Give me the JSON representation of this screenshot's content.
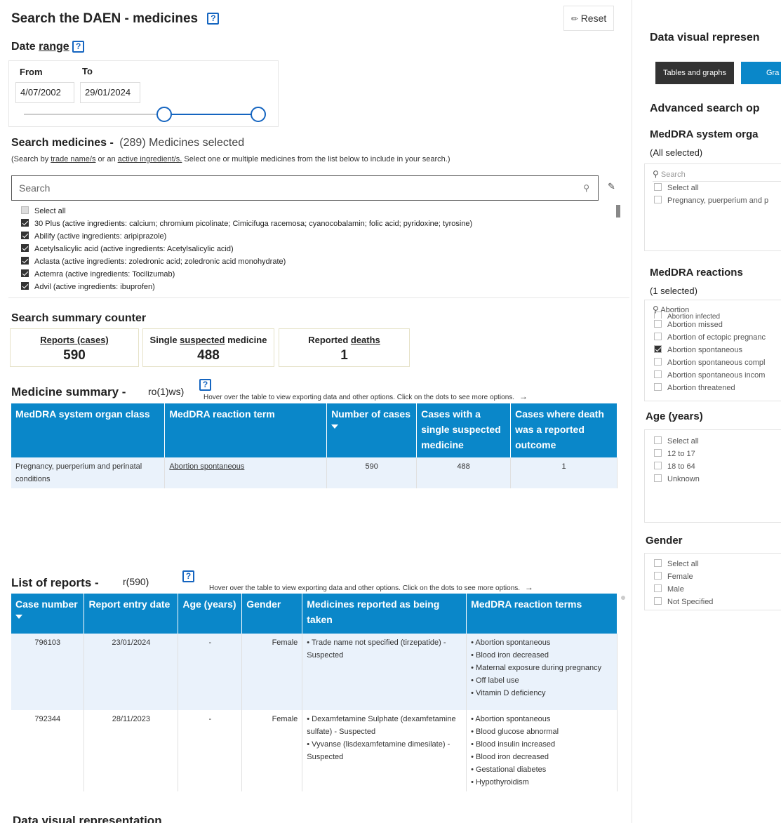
{
  "header": {
    "title": "Search the DAEN - medicines",
    "help_icon": "?",
    "reset_label": "Reset"
  },
  "date_range": {
    "title_prefix": "Date ",
    "title_link": "range",
    "from_label": "From",
    "to_label": "To",
    "from_value": "4/07/2002",
    "to_value": "29/01/2024"
  },
  "search_medicines": {
    "title": "Search medicines -",
    "count_text": "(289) Medicines selected",
    "note_1": "(Search by ",
    "note_link_1": "trade name/s",
    "note_2": " or an ",
    "note_link_2": "active ingredient/s.",
    "note_3": " Select one or multiple medicines from the list below to include in your search.)",
    "placeholder": "Search",
    "items": [
      {
        "label": "Select all",
        "state": "partial"
      },
      {
        "label": "30 Plus (active ingredients: calcium; chromium picolinate; Cimicifuga racemosa; cyanocobalamin; folic acid; pyridoxine; tyrosine)",
        "state": "checked"
      },
      {
        "label": "Abilify (active ingredients: aripiprazole)",
        "state": "checked"
      },
      {
        "label": "Acetylsalicylic acid (active ingredients: Acetylsalicylic acid)",
        "state": "checked"
      },
      {
        "label": "Aclasta (active ingredients: zoledronic acid; zoledronic acid monohydrate)",
        "state": "checked"
      },
      {
        "label": "Actemra (active ingredients: Tocilizumab)",
        "state": "checked"
      },
      {
        "label": "Advil (active ingredients: ibuprofen)",
        "state": "checked"
      }
    ]
  },
  "summary_counter": {
    "title": "Search summary counter",
    "reports_label": "Reports (cases)",
    "reports_value": "590",
    "single_prefix": "Single ",
    "single_link": "suspected",
    "single_suffix": " medicine",
    "single_value": "488",
    "deaths_prefix": "Reported ",
    "deaths_link": "deaths",
    "deaths_value": "1"
  },
  "medicine_summary": {
    "title": "Medicine summary -",
    "rows_text": "ro(1)ws)",
    "hint": "Hover over the table to view exporting data and other options. Click on the dots to see more options.",
    "columns": [
      "MedDRA system organ class",
      "MedDRA reaction term",
      "Number of cases",
      "Cases with a single suspected medicine",
      "Cases where death was a reported outcome"
    ],
    "rows": [
      [
        "Pregnancy, puerperium and perinatal conditions",
        "Abortion spontaneous",
        "590",
        "488",
        "1"
      ]
    ]
  },
  "list_of_reports": {
    "title": "List of reports -",
    "rows_text": "r(590)",
    "hint": "Hover over the table to view exporting data and other options. Click on the dots to see more options.",
    "columns": [
      "Case number",
      "Report entry date",
      "Age (years)",
      "Gender",
      "Medicines reported as being taken",
      "MedDRA reaction terms"
    ],
    "rows": [
      {
        "case": "796103",
        "date": "23/01/2024",
        "age": "-",
        "gender": "Female",
        "medicines": [
          "• Trade name not specified (tirzepatide) - Suspected"
        ],
        "reactions": [
          "• Abortion spontaneous",
          "• Blood iron decreased",
          "• Maternal exposure during pregnancy",
          "• Off label use",
          "• Vitamin D deficiency"
        ]
      },
      {
        "case": "792344",
        "date": "28/11/2023",
        "age": "-",
        "gender": "Female",
        "medicines": [
          "• Dexamfetamine Sulphate (dexamfetamine sulfate) - Suspected",
          "• Vyvanse (lisdexamfetamine dimesilate) - Suspected"
        ],
        "reactions": [
          "• Abortion spontaneous",
          "• Blood glucose abnormal",
          "• Blood insulin increased",
          "• Blood iron decreased",
          "• Gestational diabetes",
          "• Hypothyroidism"
        ]
      }
    ]
  },
  "bottom_heading": "Data visual representation",
  "right_panel": {
    "dv_title": "Data visual represen",
    "btn_tables": "Tables and graphs",
    "btn_graphs": "Gra",
    "adv_title": "Advanced search op",
    "soc_title": "MedDRA system orga",
    "soc_selected": "(All selected)",
    "soc_search": "Search",
    "soc_items": [
      "Select all",
      "Pregnancy, puerperium and p"
    ],
    "reactions_title": "MedDRA reactions",
    "reactions_selected": "(1 selected)",
    "reactions_search": "Abortion",
    "reactions_items": [
      {
        "label": "Abortion infected",
        "checked": false
      },
      {
        "label": "Abortion missed",
        "checked": false
      },
      {
        "label": "Abortion of ectopic pregnanc",
        "checked": false
      },
      {
        "label": "Abortion spontaneous",
        "checked": true
      },
      {
        "label": "Abortion spontaneous compl",
        "checked": false
      },
      {
        "label": "Abortion spontaneous incom",
        "checked": false
      },
      {
        "label": "Abortion threatened",
        "checked": false
      }
    ],
    "age_title": "Age (years)",
    "age_items": [
      "Select all",
      "12 to 17",
      "18 to 64",
      "Unknown"
    ],
    "gender_title": "Gender",
    "gender_items": [
      "Select all",
      "Female",
      "Male",
      "Not Specified"
    ]
  }
}
